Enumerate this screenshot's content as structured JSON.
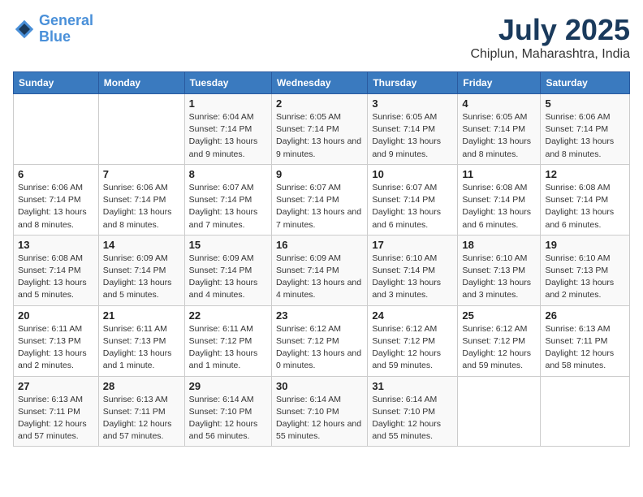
{
  "header": {
    "logo_line1": "General",
    "logo_line2": "Blue",
    "title": "July 2025",
    "subtitle": "Chiplun, Maharashtra, India"
  },
  "calendar": {
    "days_of_week": [
      "Sunday",
      "Monday",
      "Tuesday",
      "Wednesday",
      "Thursday",
      "Friday",
      "Saturday"
    ],
    "weeks": [
      [
        {
          "day": "",
          "info": ""
        },
        {
          "day": "",
          "info": ""
        },
        {
          "day": "1",
          "info": "Sunrise: 6:04 AM\nSunset: 7:14 PM\nDaylight: 13 hours and 9 minutes."
        },
        {
          "day": "2",
          "info": "Sunrise: 6:05 AM\nSunset: 7:14 PM\nDaylight: 13 hours and 9 minutes."
        },
        {
          "day": "3",
          "info": "Sunrise: 6:05 AM\nSunset: 7:14 PM\nDaylight: 13 hours and 9 minutes."
        },
        {
          "day": "4",
          "info": "Sunrise: 6:05 AM\nSunset: 7:14 PM\nDaylight: 13 hours and 8 minutes."
        },
        {
          "day": "5",
          "info": "Sunrise: 6:06 AM\nSunset: 7:14 PM\nDaylight: 13 hours and 8 minutes."
        }
      ],
      [
        {
          "day": "6",
          "info": "Sunrise: 6:06 AM\nSunset: 7:14 PM\nDaylight: 13 hours and 8 minutes."
        },
        {
          "day": "7",
          "info": "Sunrise: 6:06 AM\nSunset: 7:14 PM\nDaylight: 13 hours and 8 minutes."
        },
        {
          "day": "8",
          "info": "Sunrise: 6:07 AM\nSunset: 7:14 PM\nDaylight: 13 hours and 7 minutes."
        },
        {
          "day": "9",
          "info": "Sunrise: 6:07 AM\nSunset: 7:14 PM\nDaylight: 13 hours and 7 minutes."
        },
        {
          "day": "10",
          "info": "Sunrise: 6:07 AM\nSunset: 7:14 PM\nDaylight: 13 hours and 6 minutes."
        },
        {
          "day": "11",
          "info": "Sunrise: 6:08 AM\nSunset: 7:14 PM\nDaylight: 13 hours and 6 minutes."
        },
        {
          "day": "12",
          "info": "Sunrise: 6:08 AM\nSunset: 7:14 PM\nDaylight: 13 hours and 6 minutes."
        }
      ],
      [
        {
          "day": "13",
          "info": "Sunrise: 6:08 AM\nSunset: 7:14 PM\nDaylight: 13 hours and 5 minutes."
        },
        {
          "day": "14",
          "info": "Sunrise: 6:09 AM\nSunset: 7:14 PM\nDaylight: 13 hours and 5 minutes."
        },
        {
          "day": "15",
          "info": "Sunrise: 6:09 AM\nSunset: 7:14 PM\nDaylight: 13 hours and 4 minutes."
        },
        {
          "day": "16",
          "info": "Sunrise: 6:09 AM\nSunset: 7:14 PM\nDaylight: 13 hours and 4 minutes."
        },
        {
          "day": "17",
          "info": "Sunrise: 6:10 AM\nSunset: 7:14 PM\nDaylight: 13 hours and 3 minutes."
        },
        {
          "day": "18",
          "info": "Sunrise: 6:10 AM\nSunset: 7:13 PM\nDaylight: 13 hours and 3 minutes."
        },
        {
          "day": "19",
          "info": "Sunrise: 6:10 AM\nSunset: 7:13 PM\nDaylight: 13 hours and 2 minutes."
        }
      ],
      [
        {
          "day": "20",
          "info": "Sunrise: 6:11 AM\nSunset: 7:13 PM\nDaylight: 13 hours and 2 minutes."
        },
        {
          "day": "21",
          "info": "Sunrise: 6:11 AM\nSunset: 7:13 PM\nDaylight: 13 hours and 1 minute."
        },
        {
          "day": "22",
          "info": "Sunrise: 6:11 AM\nSunset: 7:12 PM\nDaylight: 13 hours and 1 minute."
        },
        {
          "day": "23",
          "info": "Sunrise: 6:12 AM\nSunset: 7:12 PM\nDaylight: 13 hours and 0 minutes."
        },
        {
          "day": "24",
          "info": "Sunrise: 6:12 AM\nSunset: 7:12 PM\nDaylight: 12 hours and 59 minutes."
        },
        {
          "day": "25",
          "info": "Sunrise: 6:12 AM\nSunset: 7:12 PM\nDaylight: 12 hours and 59 minutes."
        },
        {
          "day": "26",
          "info": "Sunrise: 6:13 AM\nSunset: 7:11 PM\nDaylight: 12 hours and 58 minutes."
        }
      ],
      [
        {
          "day": "27",
          "info": "Sunrise: 6:13 AM\nSunset: 7:11 PM\nDaylight: 12 hours and 57 minutes."
        },
        {
          "day": "28",
          "info": "Sunrise: 6:13 AM\nSunset: 7:11 PM\nDaylight: 12 hours and 57 minutes."
        },
        {
          "day": "29",
          "info": "Sunrise: 6:14 AM\nSunset: 7:10 PM\nDaylight: 12 hours and 56 minutes."
        },
        {
          "day": "30",
          "info": "Sunrise: 6:14 AM\nSunset: 7:10 PM\nDaylight: 12 hours and 55 minutes."
        },
        {
          "day": "31",
          "info": "Sunrise: 6:14 AM\nSunset: 7:10 PM\nDaylight: 12 hours and 55 minutes."
        },
        {
          "day": "",
          "info": ""
        },
        {
          "day": "",
          "info": ""
        }
      ]
    ]
  }
}
